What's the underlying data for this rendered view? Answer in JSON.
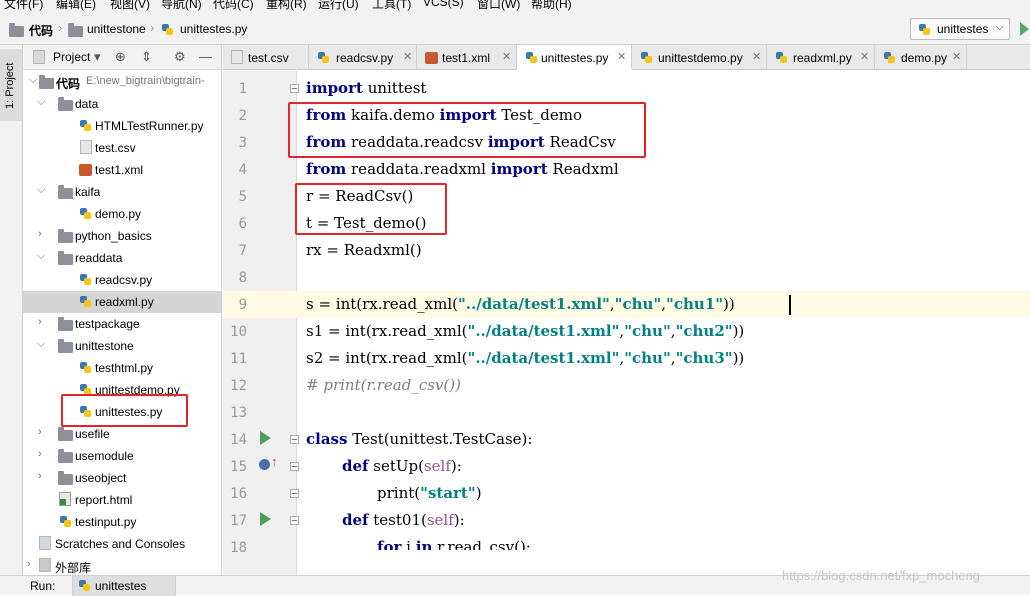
{
  "menu": [
    "文件(F)",
    "编辑(E)",
    "视图(V)",
    "导航(N)",
    "代码(C)",
    "重构(R)",
    "运行(U)",
    "工具(T)",
    "VCS(S)",
    "窗口(W)",
    "帮助(H)"
  ],
  "breadcrumb": {
    "root": "代码",
    "folder": "unittestone",
    "file": "unittestes.py"
  },
  "run_config": "unittestes",
  "toolwindow_tab": "1: Project",
  "project": {
    "view_label": "Project",
    "root_name": "代码",
    "root_path": "E:\\new_bigtrain\\bigtrain-",
    "tree": [
      {
        "label": "data"
      },
      {
        "label": "HTMLTestRunner.py"
      },
      {
        "label": "test.csv"
      },
      {
        "label": "test1.xml"
      },
      {
        "label": "kaifa"
      },
      {
        "label": "demo.py"
      },
      {
        "label": "python_basics"
      },
      {
        "label": "readdata"
      },
      {
        "label": "readcsv.py"
      },
      {
        "label": "readxml.py"
      },
      {
        "label": "testpackage"
      },
      {
        "label": "unittestone"
      },
      {
        "label": "testhtml.py"
      },
      {
        "label": "unittestdemo.py"
      },
      {
        "label": "unittestes.py"
      },
      {
        "label": "usefile"
      },
      {
        "label": "usemodule"
      },
      {
        "label": "useobject"
      },
      {
        "label": "report.html"
      },
      {
        "label": "testinput.py"
      },
      {
        "label": "Scratches and Consoles"
      },
      {
        "label": "外部库"
      }
    ]
  },
  "tabs": [
    "test.csv",
    "readcsv.py",
    "test1.xml",
    "unittestes.py",
    "unittestdemo.py",
    "readxml.py",
    "demo.py"
  ],
  "line_numbers": [
    "1",
    "2",
    "3",
    "4",
    "5",
    "6",
    "7",
    "8",
    "9",
    "10",
    "11",
    "12",
    "13",
    "14",
    "15",
    "16",
    "17",
    "18"
  ],
  "code": {
    "kw_import": "import",
    "kw_from": "from",
    "kw_class": "class",
    "kw_def": "def",
    "kw_for": "for",
    "kw_in": "in",
    "l1_mod": "unittest",
    "l2_mod": "kaifa.demo",
    "l2_name": "Test_demo",
    "l3_mod": "readdata.readcsv",
    "l3_name": "ReadCsv",
    "l4_mod": "readdata.readxml",
    "l4_name": "Readxml",
    "l5": "r = ReadCsv()",
    "l6": "t = Test_demo()",
    "l7": "rx = Readxml()",
    "l9_pre": "s = int(rx.read_xml(",
    "l10_pre": "s1 = int(rx.read_xml(",
    "l11_pre": "s2 = int(rx.read_xml(",
    "path": "\"../data/test1.xml\"",
    "chu": "\"chu\"",
    "comma": ",",
    "chu1": "\"chu1\"",
    "chu2": "\"chu2\"",
    "chu3": "\"chu3\"",
    "close": "))",
    "l12": "# print(r.read_csv())",
    "l14_name": "Test",
    "l14_rest": "(unittest.TestCase):",
    "l15_name": "setUp",
    "l17_name": "test01",
    "self": "self",
    "lpar": "(",
    "rparcolon": "):",
    "l16_fn": "print",
    "l16_str": "\"start\"",
    "l16_close": ")",
    "l18_rest": "i",
    "l18_tail": "r.read_csv():"
  },
  "bottom": {
    "run_label": "Run:",
    "run_tab": "unittestes"
  },
  "watermark": "https://blog.csdn.net/fxp_mocheng"
}
